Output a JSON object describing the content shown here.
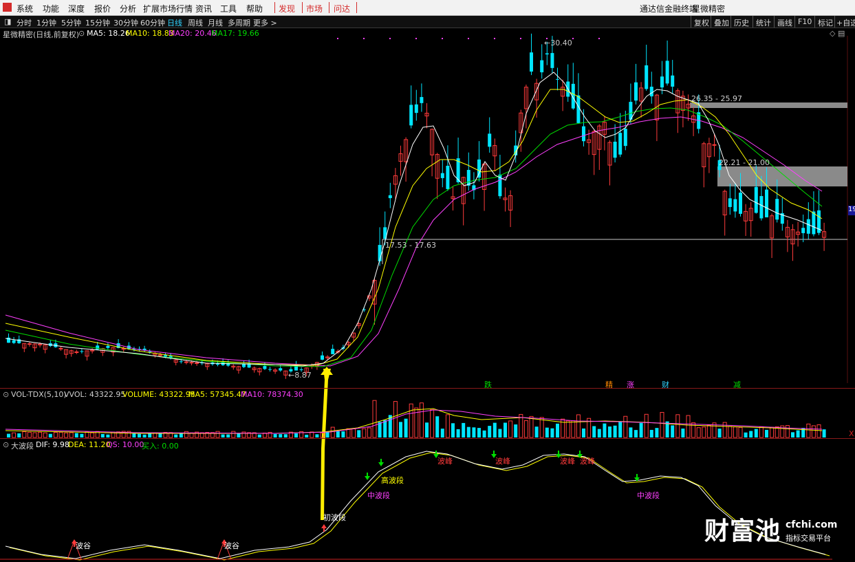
{
  "menu": {
    "items": [
      "系统",
      "功能",
      "深度",
      "报价",
      "分析",
      "扩展市场行情",
      "资讯",
      "工具",
      "帮助"
    ],
    "hot_items": [
      "发现",
      "市场",
      "问达"
    ],
    "app_title": "通达信金融终端",
    "stock_title": "星微精密"
  },
  "toolbar": {
    "periods": [
      "分时",
      "1分钟",
      "5分钟",
      "15分钟",
      "30分钟",
      "60分钟",
      "日线",
      "周线",
      "月线",
      "多周期",
      "更多 >"
    ],
    "active_period": "日线",
    "right_buttons": [
      "复权",
      "叠加",
      "历史",
      "统计",
      "画线",
      "F10",
      "标记",
      "+自选"
    ]
  },
  "main_chart": {
    "title": "星微精密(日线,前复权)",
    "ma5": "MA5: 18.26",
    "ma10": "MA10: 18.83",
    "ma20": "MA20: 20.46",
    "ma17": "MA17: 19.66",
    "high_label": "30.40",
    "low_label": "8.87",
    "zone1": "26.35 - 25.97",
    "zone2": "22.21 - 21.00",
    "zone3": "17.53 - 17.63",
    "edge_label": "19",
    "signals": [
      "跌",
      "精",
      "涨",
      "财",
      "减"
    ]
  },
  "volume_panel": {
    "title": "VOL-TDX(5,10)",
    "vvol": "VVOL: 43322.95",
    "volume": "VOLUME: 43322.95",
    "ma5": "MA5: 57345.47",
    "ma10": "MA10: 78374.30",
    "edge_label": "X"
  },
  "wave_panel": {
    "title": "大波段",
    "dif": "DIF: 9.98",
    "dea": "DEA: 11.20",
    "qs": "QS: 10.00",
    "buy": "买入: 0.00",
    "labels": {
      "trough1": "波谷",
      "trough2": "波谷",
      "initial": "初波段",
      "mid1": "中波段",
      "high": "高波段",
      "peak1": "波峰",
      "peak2": "波峰",
      "peak3": "波峰",
      "peak4": "波峰",
      "mid2": "中波段"
    }
  },
  "watermark": {
    "brand": "财富池",
    "domain": "cfchi.com",
    "tagline": "指标交易平台"
  },
  "colors": {
    "up": "#ff3b3b",
    "down": "#00e5ff",
    "ma5": "#ffffff",
    "ma10": "#ffff00",
    "ma20": "#ff40ff",
    "ma17": "#00dd00",
    "zone": "#8a8a8a",
    "arrow": "#ffee00"
  }
}
